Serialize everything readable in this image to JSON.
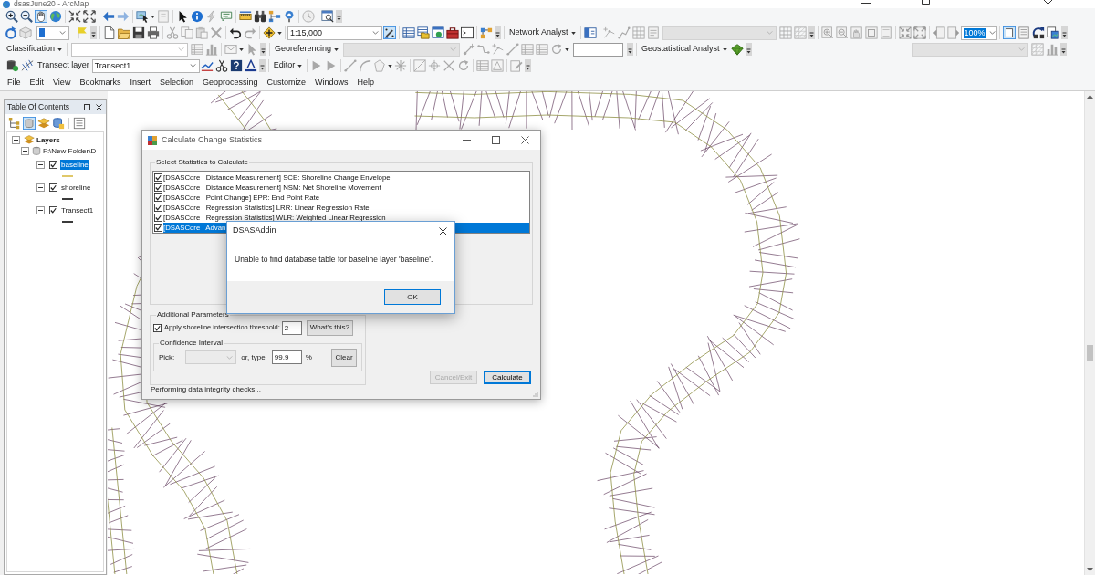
{
  "window": {
    "title": "dsasJune20 - ArcMap"
  },
  "toolbar_controls": [
    {
      "kind": "dropdown",
      "value": "1:15,000",
      "selected": false
    },
    {
      "kind": "menu",
      "label": "Network Analyst"
    },
    {
      "kind": "dropdown",
      "value": "100%",
      "selected": true
    },
    {
      "kind": "menu",
      "label": "Classification"
    },
    {
      "kind": "menu",
      "label": "Georeferencing"
    },
    {
      "kind": "menu",
      "label": "Geostatistical Analyst"
    },
    {
      "kind": "label",
      "label": "Transect layer"
    },
    {
      "kind": "dropdown",
      "value": "Transect1",
      "selected": false
    },
    {
      "kind": "menu",
      "label": "Editor"
    }
  ],
  "menu_bar": [
    "File",
    "Edit",
    "View",
    "Bookmarks",
    "Insert",
    "Selection",
    "Geoprocessing",
    "Customize",
    "Windows",
    "Help"
  ],
  "table_of_contents": {
    "title": "Table Of Contents",
    "layers": [
      {
        "kind": "data_frame",
        "label": "Layers",
        "expanded": true,
        "selected": false,
        "children": [
          {
            "kind": "workspace",
            "label": "F:\\New Folder\\D",
            "expanded": true,
            "selected": false,
            "children": [
              {
                "kind": "layer",
                "label": "baseline",
                "expanded": true,
                "checked": true,
                "selected": true,
                "color": "#e0c86a"
              },
              {
                "kind": "layer",
                "label": "shoreline",
                "expanded": true,
                "checked": true,
                "selected": false,
                "color": "#3a3a3a"
              },
              {
                "kind": "layer",
                "label": "Transect1",
                "expanded": true,
                "checked": true,
                "selected": false,
                "color": "#3a3a3a"
              }
            ]
          }
        ]
      }
    ]
  },
  "dialog": {
    "title": "Calculate Change Statistics",
    "statistics": {
      "title": "Select Statistics to Calculate",
      "items": [
        {
          "label": "[DSASCore | Distance Measurement] SCE: Shoreline Change Envelope",
          "checked": true,
          "selected": false
        },
        {
          "label": "[DSASCore | Distance Measurement] NSM: Net Shoreline Movement",
          "checked": true,
          "selected": false
        },
        {
          "label": "[DSASCore | Point Change] EPR: End Point Rate",
          "checked": true,
          "selected": false
        },
        {
          "label": "[DSASCore | Regression Statistics] LRR: Linear Regression Rate",
          "checked": true,
          "selected": false
        },
        {
          "label": "[DSASCore | Regression Statistics] WLR: Weighted Linear Regression",
          "checked": true,
          "selected": false
        },
        {
          "label": "[DSASCore | Advan",
          "checked": true,
          "selected": true
        }
      ]
    },
    "parameters": {
      "title": "Additional Parameters",
      "threshold": {
        "label": "Apply shoreline intersection threshold:",
        "checked": true,
        "value": "2"
      },
      "help_button": "What's this?",
      "confidence": {
        "title": "Confidence Interval",
        "pick_label": "Pick:",
        "pick_disabled": true,
        "type_label": "or, type:",
        "value": "99.9",
        "unit": "%",
        "clear_button": "Clear"
      }
    },
    "buttons": [
      {
        "label": "Cancel/Exit",
        "disabled": true,
        "default": false
      },
      {
        "label": "Calculate",
        "disabled": false,
        "default": true
      }
    ],
    "status": "Performing data integrity checks..."
  },
  "message_box": {
    "title": "DSASAddin",
    "message": "Unable to find database table for baseline layer 'baseline'.",
    "button": "OK"
  }
}
